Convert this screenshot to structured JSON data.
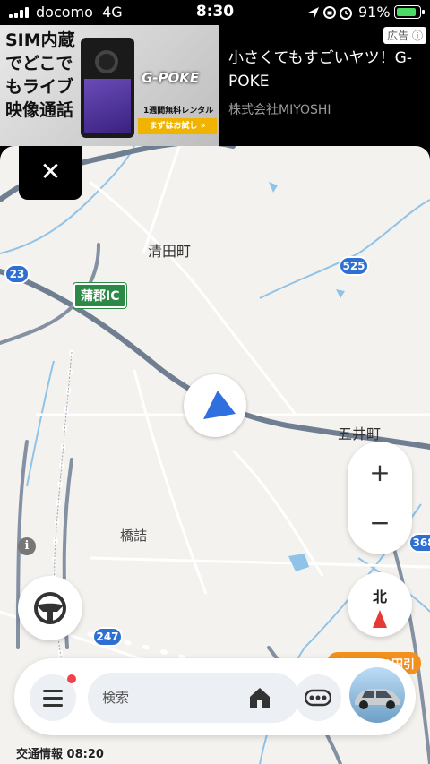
{
  "status_bar": {
    "carrier": "docomo",
    "network": "4G",
    "time": "8:30",
    "battery_percent": "91%",
    "battery_level": 0.91,
    "icons": [
      "location-arrow-icon",
      "rotation-lock-icon",
      "alarm-icon",
      "battery-charging-icon"
    ]
  },
  "ad": {
    "image_text": "SIM内蔵でどこでもライブ映像通話",
    "image_brand": "G-POKE",
    "image_rental": "1週間無料レンタル",
    "image_cta": "まずはお試し »",
    "title": "小さくてもすごいヤツ！G-POKE",
    "advertiser": "株式会社MIYOSHI",
    "badge": "広告"
  },
  "map": {
    "labels": {
      "kiyota": "清田町",
      "goi": "五井町",
      "hashizume": "橋詰"
    },
    "routes": {
      "r23": "23",
      "r525": "525",
      "r247": "247",
      "r368": "368"
    },
    "interchange": "蒲郡IC",
    "colors": {
      "background": "#f4f2ee",
      "main_road": "#6f7e90",
      "river": "#8fc3e8",
      "current_location": "#2f6fe0",
      "compass_arrow": "#e53935",
      "promo": "#f2911e"
    }
  },
  "controls": {
    "close": "✕",
    "zoom_in": "+",
    "zoom_out": "−",
    "north": "北"
  },
  "bottom_bar": {
    "search_placeholder": "検索",
    "promo_badge": "ガソリン７円引"
  },
  "traffic_info": "交通情報 08:20"
}
